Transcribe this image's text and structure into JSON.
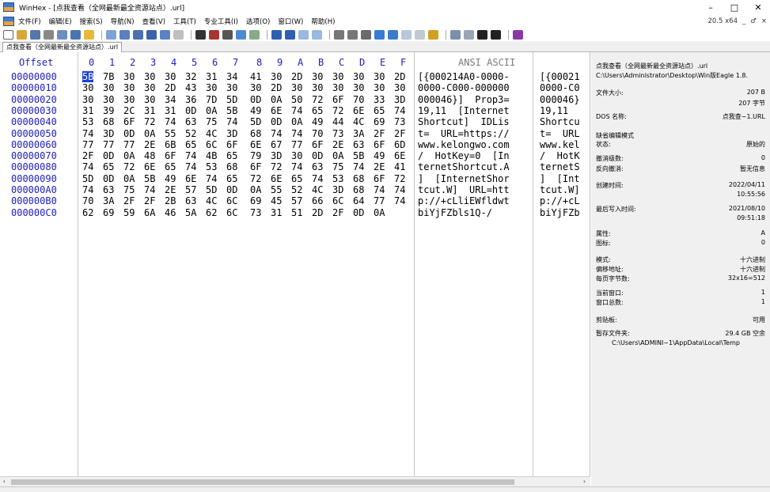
{
  "window": {
    "title": "WinHex - [点我查看（全网最新最全资源站点）.url]",
    "controls": [
      "–",
      "□",
      "✕"
    ]
  },
  "menu": {
    "items": [
      "文件(F)",
      "编辑(E)",
      "搜索(S)",
      "导航(N)",
      "查看(V)",
      "工具(T)",
      "专业工具(I)",
      "选项(O)",
      "窗口(W)",
      "帮助(H)"
    ],
    "version": "20.5 x64",
    "mdi_controls": [
      "_",
      "♂",
      "×"
    ]
  },
  "tab": {
    "label": "点我查看（全网最新最全资源站点）.url"
  },
  "hex": {
    "offset_header": "Offset",
    "column_headers": [
      "0",
      "1",
      "2",
      "3",
      "4",
      "5",
      "6",
      "7",
      "8",
      "9",
      "A",
      "B",
      "C",
      "D",
      "E",
      "F"
    ],
    "ascii_header": "ANSI ASCII",
    "rows": [
      {
        "offset": "00000000",
        "bytes": [
          "5B",
          "7B",
          "30",
          "30",
          "30",
          "32",
          "31",
          "34",
          "41",
          "30",
          "2D",
          "30",
          "30",
          "30",
          "30",
          "2D"
        ],
        "ascii": "[{000214A0-0000-",
        "ascii2": "[{00021"
      },
      {
        "offset": "00000010",
        "bytes": [
          "30",
          "30",
          "30",
          "30",
          "2D",
          "43",
          "30",
          "30",
          "30",
          "2D",
          "30",
          "30",
          "30",
          "30",
          "30",
          "30"
        ],
        "ascii": "0000-C000-000000",
        "ascii2": "0000-C0"
      },
      {
        "offset": "00000020",
        "bytes": [
          "30",
          "30",
          "30",
          "30",
          "34",
          "36",
          "7D",
          "5D",
          "0D",
          "0A",
          "50",
          "72",
          "6F",
          "70",
          "33",
          "3D"
        ],
        "ascii": "000046}]  Prop3=",
        "ascii2": "000046}"
      },
      {
        "offset": "00000030",
        "bytes": [
          "31",
          "39",
          "2C",
          "31",
          "31",
          "0D",
          "0A",
          "5B",
          "49",
          "6E",
          "74",
          "65",
          "72",
          "6E",
          "65",
          "74"
        ],
        "ascii": "19,11  [Internet",
        "ascii2": "19,11"
      },
      {
        "offset": "00000040",
        "bytes": [
          "53",
          "68",
          "6F",
          "72",
          "74",
          "63",
          "75",
          "74",
          "5D",
          "0D",
          "0A",
          "49",
          "44",
          "4C",
          "69",
          "73"
        ],
        "ascii": "Shortcut]  IDLis",
        "ascii2": "Shortcu"
      },
      {
        "offset": "00000050",
        "bytes": [
          "74",
          "3D",
          "0D",
          "0A",
          "55",
          "52",
          "4C",
          "3D",
          "68",
          "74",
          "74",
          "70",
          "73",
          "3A",
          "2F",
          "2F"
        ],
        "ascii": "t=  URL=https://",
        "ascii2": "t=  URL"
      },
      {
        "offset": "00000060",
        "bytes": [
          "77",
          "77",
          "77",
          "2E",
          "6B",
          "65",
          "6C",
          "6F",
          "6E",
          "67",
          "77",
          "6F",
          "2E",
          "63",
          "6F",
          "6D"
        ],
        "ascii": "www.kelongwo.com",
        "ascii2": "www.kel"
      },
      {
        "offset": "00000070",
        "bytes": [
          "2F",
          "0D",
          "0A",
          "48",
          "6F",
          "74",
          "4B",
          "65",
          "79",
          "3D",
          "30",
          "0D",
          "0A",
          "5B",
          "49",
          "6E"
        ],
        "ascii": "/  HotKey=0  [In",
        "ascii2": "/  HotK"
      },
      {
        "offset": "00000080",
        "bytes": [
          "74",
          "65",
          "72",
          "6E",
          "65",
          "74",
          "53",
          "68",
          "6F",
          "72",
          "74",
          "63",
          "75",
          "74",
          "2E",
          "41"
        ],
        "ascii": "ternetShortcut.A",
        "ascii2": "ternetS"
      },
      {
        "offset": "00000090",
        "bytes": [
          "5D",
          "0D",
          "0A",
          "5B",
          "49",
          "6E",
          "74",
          "65",
          "72",
          "6E",
          "65",
          "74",
          "53",
          "68",
          "6F",
          "72"
        ],
        "ascii": "]  [InternetShor",
        "ascii2": "]  [Int"
      },
      {
        "offset": "000000A0",
        "bytes": [
          "74",
          "63",
          "75",
          "74",
          "2E",
          "57",
          "5D",
          "0D",
          "0A",
          "55",
          "52",
          "4C",
          "3D",
          "68",
          "74",
          "74"
        ],
        "ascii": "tcut.W]  URL=htt",
        "ascii2": "tcut.W]"
      },
      {
        "offset": "000000B0",
        "bytes": [
          "70",
          "3A",
          "2F",
          "2F",
          "2B",
          "63",
          "4C",
          "6C",
          "69",
          "45",
          "57",
          "66",
          "6C",
          "64",
          "77",
          "74"
        ],
        "ascii": "p://+cLliEWfldwt",
        "ascii2": "p://+cL"
      },
      {
        "offset": "000000C0",
        "bytes": [
          "62",
          "69",
          "59",
          "6A",
          "46",
          "5A",
          "62",
          "6C",
          "73",
          "31",
          "51",
          "2D",
          "2F",
          "0D",
          "0A"
        ],
        "ascii": "biYjFZbls1Q-/",
        "ascii2": "biYjFZb"
      }
    ]
  },
  "info_panel": {
    "filename": "点我查看（全网最新最全资源站点）.url",
    "path": "C:\\Users\\Administrator\\Desktop\\Win版Eagle 1.8.",
    "file_size_label": "文件大小:",
    "file_size_bytes": "207 B",
    "file_size_zh": "207 字节",
    "dos_name_label": "DOS 名称:",
    "dos_name": "点我查~1.URL",
    "edit_mode_label": "缺省编辑模式",
    "state_label": "状态:",
    "state": "原始的",
    "undo_level_label": "撤消级数:",
    "undo_level": "0",
    "undo_reverse_label": "反向撤消:",
    "undo_reverse": "暂无信息",
    "created_label": "创建时间:",
    "created_date": "2022/04/11",
    "created_time": "10:55:56",
    "modified_label": "最后写入时间:",
    "modified_date": "2021/08/10",
    "modified_time": "09:51:18",
    "attr_label": "属性:",
    "attr": "A",
    "icon_label": "图标:",
    "icon": "0",
    "mode_label": "模式:",
    "mode": "十六进制",
    "offset_addr_label": "偏移地址:",
    "offset_addr": "十六进制",
    "bytes_per_page_label": "每页字节数:",
    "bytes_per_page": "32x16=512",
    "current_window_label": "当前窗口:",
    "current_window": "1",
    "window_total_label": "窗口总数:",
    "window_total": "1",
    "clipboard_label": "剪贴板:",
    "clipboard": "可用",
    "temp_folder_label": "暂存文件夹:",
    "temp_folder_free": "29.4 GB 空余",
    "temp_folder_path": "C:\\Users\\ADMINI~1\\AppData\\Local\\Temp"
  },
  "colors": {
    "offset_blue": "#2020c0",
    "selection": "#1a3fd6",
    "panel_bg": "#f0f0f0"
  }
}
